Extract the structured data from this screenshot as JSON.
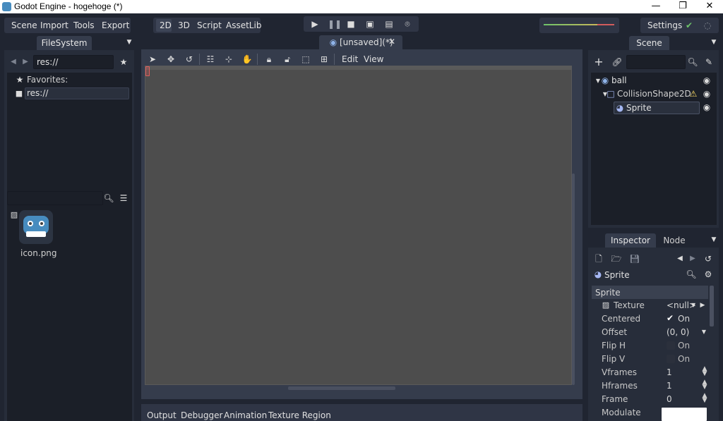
{
  "window": {
    "title": "Godot Engine - hogehoge (*)",
    "minimize": "—",
    "maximize": "❐",
    "close": "✕"
  },
  "menubar": {
    "items": [
      "Scene",
      "Import",
      "Tools",
      "Export"
    ]
  },
  "workspaces": {
    "items": [
      "2D",
      "3D",
      "Script",
      "AssetLib"
    ],
    "active": "2D"
  },
  "playback": {
    "buttons": [
      "play-icon",
      "pause-icon",
      "stop-icon",
      "play-scene-icon",
      "play-custom-icon",
      "remote-debug-icon"
    ]
  },
  "settings": {
    "label": "Settings"
  },
  "filesystem": {
    "dock_title": "FileSystem",
    "path_value": "res://",
    "favorites_label": "Favorites:",
    "tree_root": "res://",
    "search_value": "",
    "files": [
      {
        "name": "icon.png",
        "icon": "godot-logo-icon"
      }
    ]
  },
  "scene_tab": {
    "label": "[unsaved](*)",
    "close": "✕"
  },
  "viewport_toolbar": {
    "menus": [
      "Edit",
      "View"
    ]
  },
  "bottom_panel": {
    "tabs": [
      "Output",
      "Debugger",
      "Animation",
      "Texture Region"
    ]
  },
  "scene_dock": {
    "title": "Scene",
    "filter_value": "",
    "tree": [
      {
        "name": "ball",
        "icon": "node2d-icon",
        "depth": 0
      },
      {
        "name": "CollisionShape2D",
        "icon": "collision-shape-icon",
        "depth": 1,
        "warning": true
      },
      {
        "name": "Sprite",
        "icon": "sprite-icon",
        "depth": 2,
        "selected": true
      }
    ]
  },
  "inspector": {
    "tabs": [
      "Inspector",
      "Node"
    ],
    "active_tab": "Inspector",
    "object_name": "Sprite",
    "section": "Sprite",
    "properties": [
      {
        "key": "Texture",
        "value": "<null>",
        "type": "resource"
      },
      {
        "key": "Centered",
        "value": "On",
        "type": "bool",
        "checked": true
      },
      {
        "key": "Offset",
        "value": "(0, 0)",
        "type": "vector"
      },
      {
        "key": "Flip H",
        "value": "On",
        "type": "bool",
        "checked": false
      },
      {
        "key": "Flip V",
        "value": "On",
        "type": "bool",
        "checked": false
      },
      {
        "key": "Vframes",
        "value": "1",
        "type": "int"
      },
      {
        "key": "Hframes",
        "value": "1",
        "type": "int"
      },
      {
        "key": "Frame",
        "value": "0",
        "type": "int"
      },
      {
        "key": "Modulate",
        "value": "",
        "type": "color",
        "color": "#ffffff"
      }
    ]
  },
  "colors": {
    "background": "#202531",
    "panel": "#272d3a",
    "viewport": "#4d4d4d",
    "accent": "#699ce8",
    "warning": "#ffdd65"
  }
}
